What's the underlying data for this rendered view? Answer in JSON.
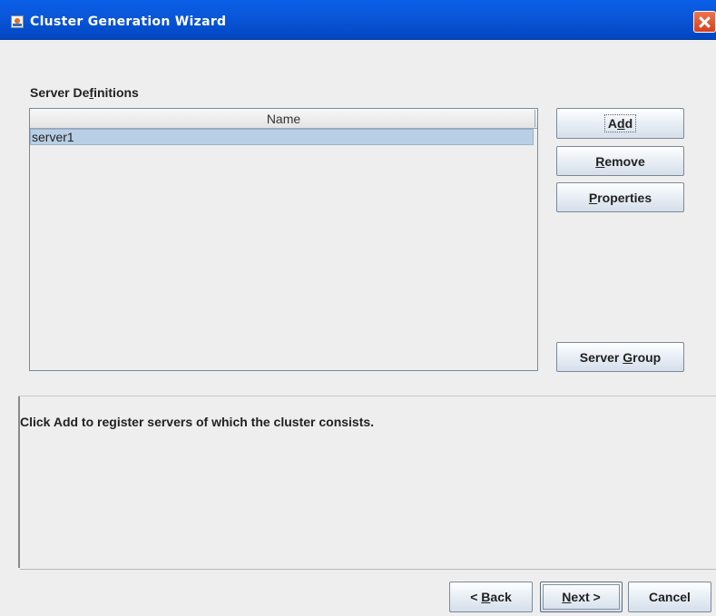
{
  "window": {
    "title": "Cluster Generation Wizard"
  },
  "server_definitions": {
    "label_pre": "Server De",
    "label_ul": "f",
    "label_post": "initions",
    "columns": [
      "Name"
    ],
    "rows": [
      {
        "name": "server1",
        "selected": true
      }
    ]
  },
  "buttons": {
    "add": {
      "pre": "A",
      "ul": "d",
      "post": "d"
    },
    "remove": {
      "pre": "",
      "ul": "R",
      "post": "emove"
    },
    "properties": {
      "pre": "",
      "ul": "P",
      "post": "roperties"
    },
    "server_group": {
      "pre": "Server ",
      "ul": "G",
      "post": "roup"
    }
  },
  "description": {
    "text": "Click Add to register servers of which the cluster consists."
  },
  "navigation": {
    "back": {
      "pre": "< ",
      "ul": "B",
      "post": "ack"
    },
    "next": {
      "pre": "",
      "ul": "N",
      "post": "ext >"
    },
    "cancel": "Cancel"
  },
  "colors": {
    "titlebar": "#0a56d8",
    "selected_row": "#b8cfe5",
    "background": "#eeeeee"
  },
  "icons": {
    "app": "java-cup-icon",
    "close": "close-icon"
  }
}
